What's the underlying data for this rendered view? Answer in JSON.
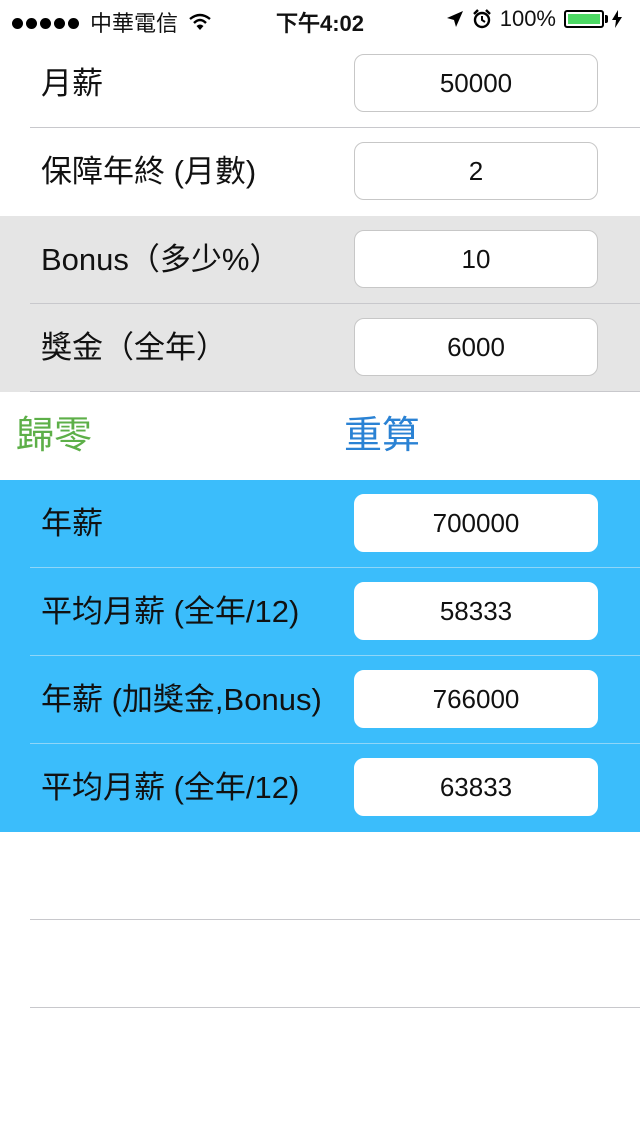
{
  "status_bar": {
    "carrier": "中華電信",
    "time": "下午4:02",
    "battery": "100%"
  },
  "inputs": [
    {
      "label": "月薪",
      "value": "50000"
    },
    {
      "label": "保障年終 (月數)",
      "value": "2"
    },
    {
      "label": "Bonus（多少%）",
      "value": "10"
    },
    {
      "label": "獎金（全年）",
      "value": "6000"
    }
  ],
  "actions": {
    "reset_label": "歸零",
    "recalc_label": "重算"
  },
  "results": [
    {
      "label": "年薪",
      "value": "700000"
    },
    {
      "label": "平均月薪 (全年/12)",
      "value": "58333"
    },
    {
      "label": "年薪 (加獎金,Bonus)",
      "value": "766000"
    },
    {
      "label": "平均月薪 (全年/12)",
      "value": "63833"
    }
  ],
  "colors": {
    "gray_band": "#e5e5e5",
    "blue_band": "#3bbdfb",
    "reset_green": "#5daf48",
    "recalc_blue": "#2a82d4"
  }
}
